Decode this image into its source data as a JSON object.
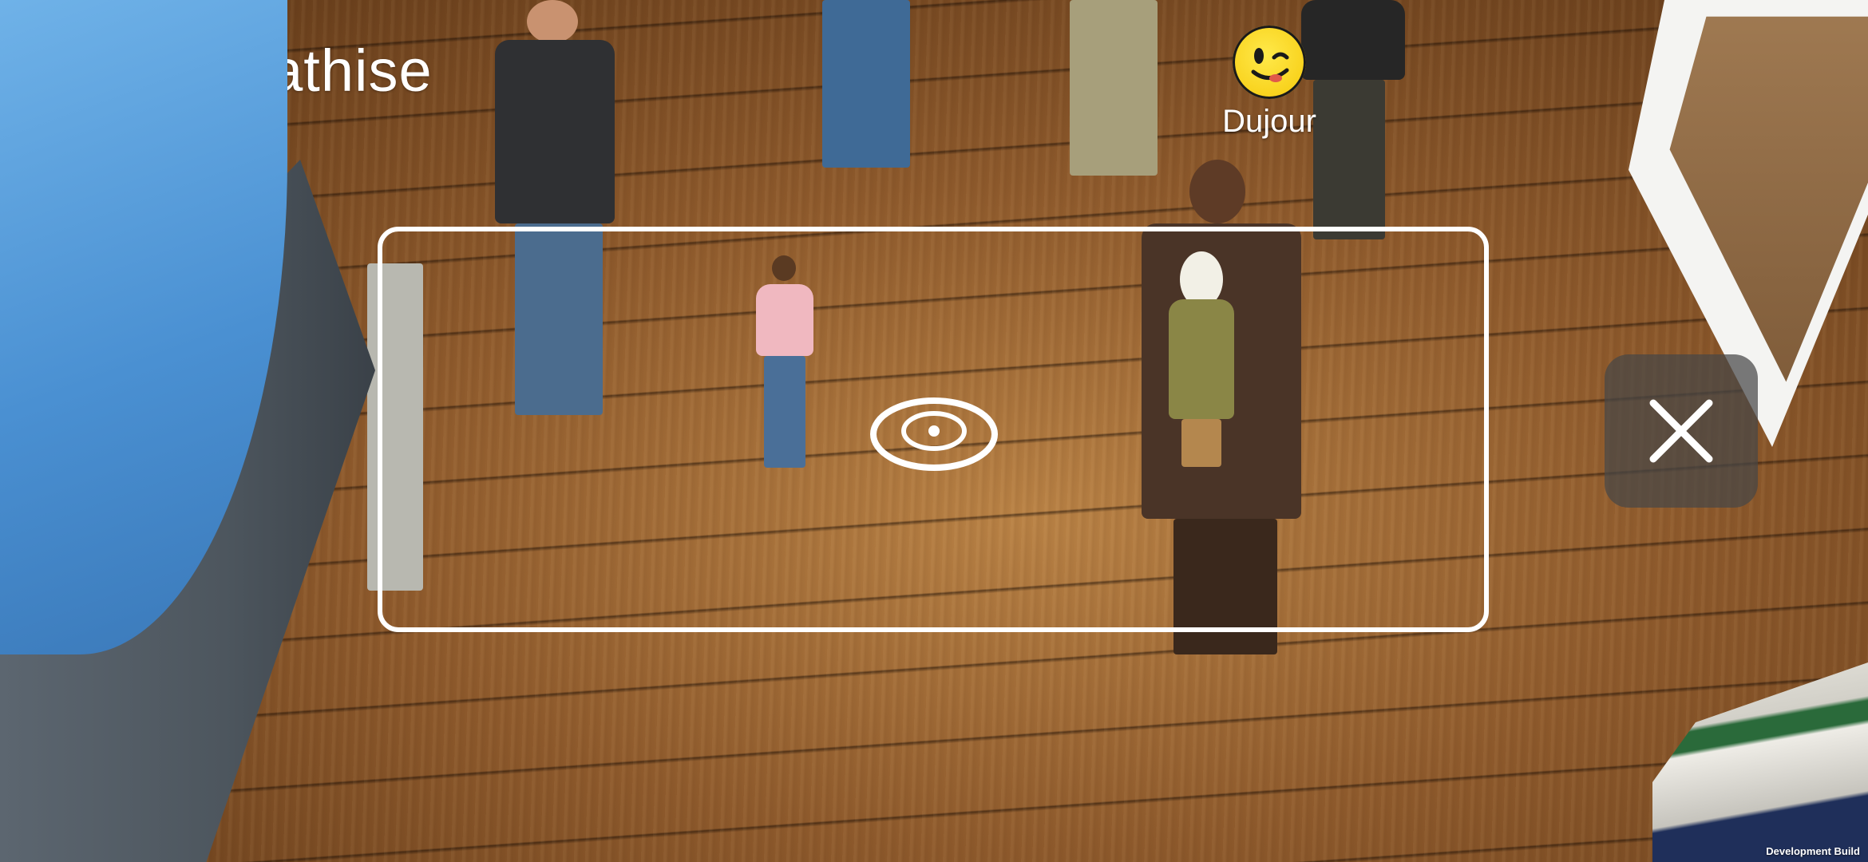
{
  "app": {
    "title": "Empathise",
    "logo_icon": "brain-icon"
  },
  "session": {
    "user_name": "Dujour",
    "user_emoji_icon": "winking-face-icon"
  },
  "scene": {
    "placement_reticle_icon": "eye-reticle-icon",
    "close_icon": "close-icon"
  },
  "footer": {
    "build_label": "Development Build"
  },
  "colors": {
    "accent_purple": "#6a3de0",
    "frame_white": "#ffffff",
    "close_bg": "#464646",
    "emoji_yellow": "#f8d21c"
  }
}
